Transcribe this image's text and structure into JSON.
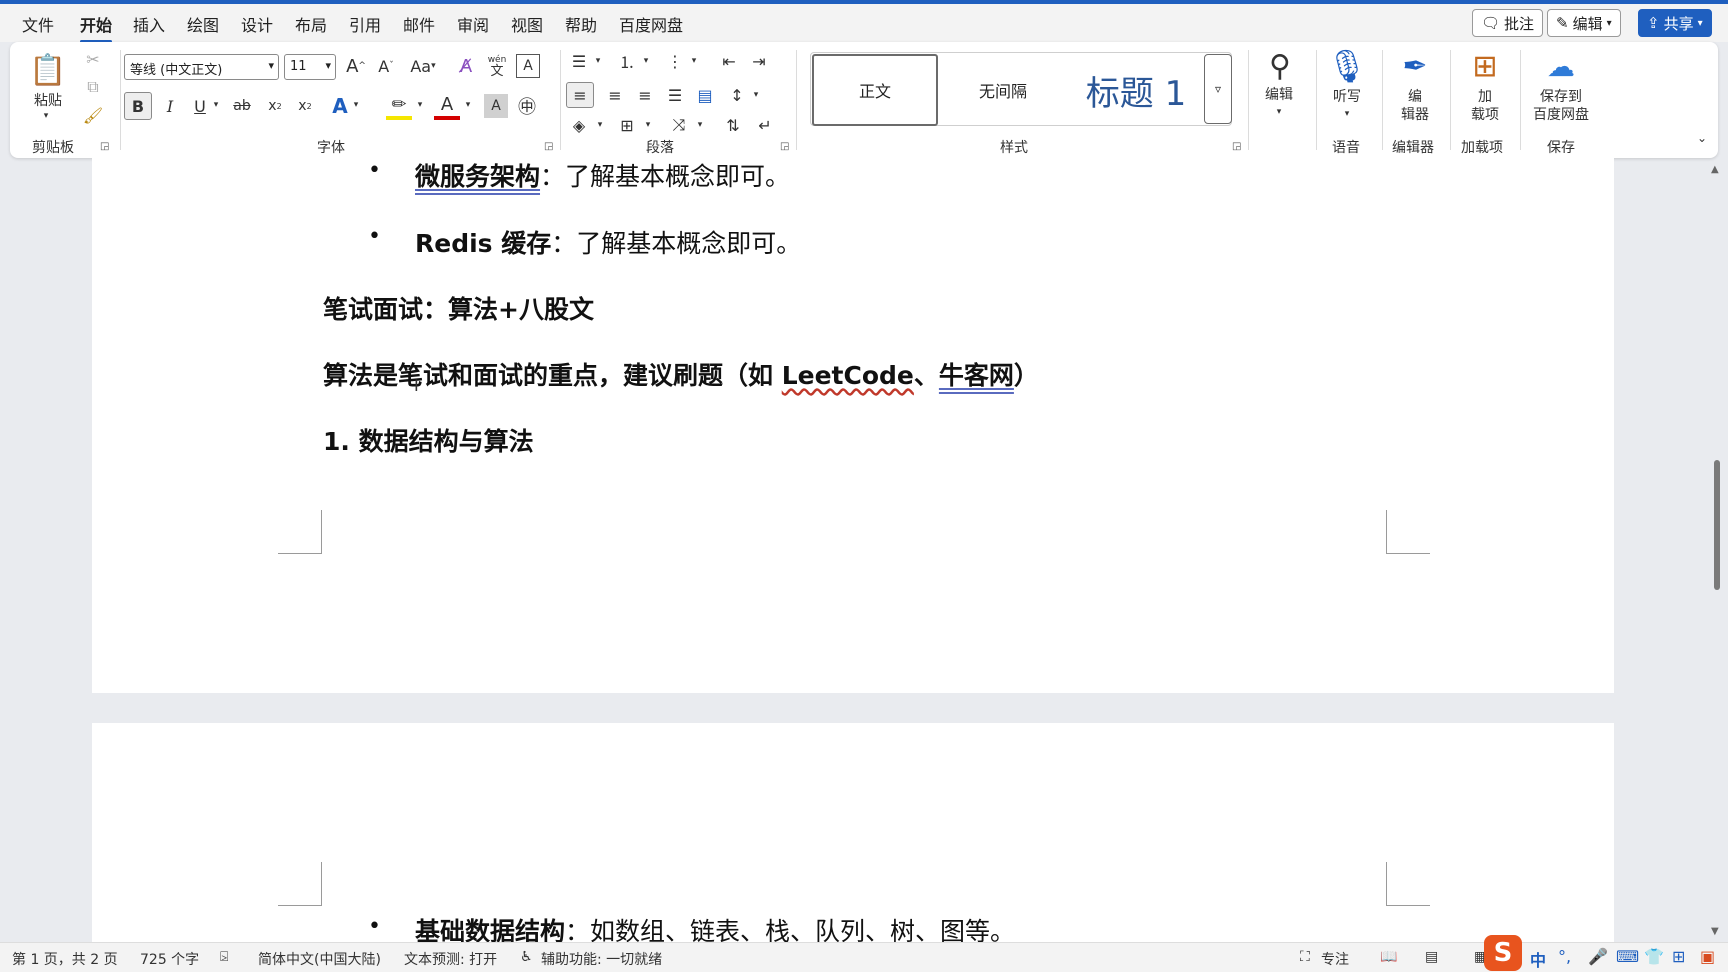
{
  "menu": {
    "tabs": [
      "文件",
      "开始",
      "插入",
      "绘图",
      "设计",
      "布局",
      "引用",
      "邮件",
      "审阅",
      "视图",
      "帮助",
      "百度网盘"
    ],
    "active_tab": "开始",
    "comment_button": "批注",
    "edit_button": "编辑",
    "share_button": "共享"
  },
  "ribbon": {
    "clipboard": {
      "paste_label": "粘贴",
      "group_label": "剪贴板"
    },
    "font": {
      "font_name": "等线 (中文正文)",
      "font_size": "11",
      "case_label": "Aa",
      "bold": "B",
      "italic": "I",
      "underline": "U",
      "strike": "ab",
      "subscript": "x",
      "superscript": "x",
      "text_effect": "A",
      "font_color": "A",
      "shading": "A",
      "grow": "A",
      "shrink": "A",
      "phonetic_top": "wén",
      "phonetic_bottom": "文",
      "border_char": "A",
      "group_label": "字体"
    },
    "paragraph": {
      "group_label": "段落"
    },
    "styles": {
      "items": [
        "正文",
        "无间隔",
        "标题 1"
      ],
      "group_label": "样式"
    },
    "editing": {
      "label": "编辑"
    },
    "voice": {
      "dictate_label": "听写",
      "group_label": "语音"
    },
    "editor": {
      "label_line1": "编",
      "label_line2": "辑器",
      "group_label": "编辑器"
    },
    "addins": {
      "label_line1": "加",
      "label_line2": "载项",
      "group_label": "加载项"
    },
    "save": {
      "label_line1": "保存到",
      "label_line2": "百度网盘",
      "group_label": "保存"
    }
  },
  "document": {
    "bullet1_bold": "微服务架构",
    "bullet1_rest": "：了解基本概念即可。",
    "bullet2_bold": "Redis 缓存",
    "bullet2_rest": "：了解基本概念即可。",
    "heading1": "笔试面试：算法+八股文",
    "para_prefix": "算法是笔试和面试的重点，建议刷题（如 ",
    "para_leetcode": "LeetCode",
    "para_sep": "、",
    "para_niuke": "牛客网",
    "para_suffix": "）",
    "heading2": "1. 数据结构与算法",
    "bullet3_bold": "基础数据结构",
    "bullet3_rest": "：如数组、链表、栈、队列、树、图等。"
  },
  "status": {
    "page": "第 1 页，共 2 页",
    "words": "725 个字",
    "language": "简体中文(中国大陆)",
    "prediction": "文本预测: 打开",
    "accessibility": "辅助功能: 一切就绪",
    "focus": "专注"
  },
  "ime": {
    "lang": "中",
    "punct": "°,"
  }
}
